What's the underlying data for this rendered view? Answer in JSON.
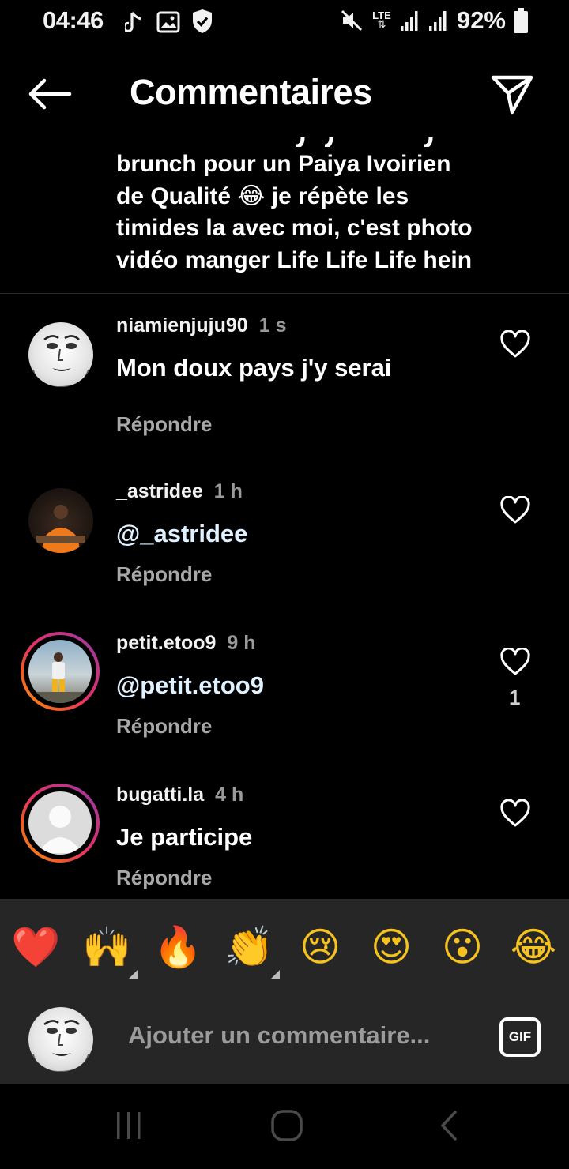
{
  "status_bar": {
    "time": "04:46",
    "lte": "LTE",
    "battery": "92%",
    "icons": [
      "music-note-icon",
      "image-icon",
      "shield-icon",
      "mute-icon",
      "lte-icon",
      "signal-icon",
      "signal-icon",
      "battery-icon"
    ]
  },
  "header": {
    "title": "Commentaires",
    "back_icon": "arrow-left-icon",
    "send_icon": "send-icon"
  },
  "caption": {
    "line1": "brunch  pour un Paiya Ivoirien",
    "line2": "de Qualité 😂 je répète les",
    "line3": "timides la avec moi, c'est photo",
    "line4": "vidéo manger Life Life Life hein"
  },
  "comments": [
    {
      "username": "niamienjuju90",
      "time": "1 s",
      "text": "Mon doux pays j'y serai",
      "reply": "Répondre",
      "likes": ""
    },
    {
      "username": "_astridee",
      "time": "1 h",
      "text": "@_astridee",
      "reply": "Répondre",
      "likes": ""
    },
    {
      "username": "petit.etoo9",
      "time": "9 h",
      "text": "@petit.etoo9",
      "reply": "Répondre",
      "likes": "1"
    },
    {
      "username": "bugatti.la",
      "time": "4 h",
      "text": "Je participe",
      "reply": "Répondre",
      "likes": ""
    }
  ],
  "emoji_bar": [
    "❤️",
    "🙌",
    "🔥",
    "👏",
    "😢",
    "😍",
    "😮",
    "😂"
  ],
  "composer": {
    "placeholder": "Ajouter un commentaire...",
    "gif_label": "GIF"
  },
  "nav_bar": {
    "icons": [
      "recent-apps-icon",
      "home-icon",
      "back-icon"
    ]
  },
  "colors": {
    "background": "#000000",
    "panel": "#262626",
    "mention": "#e0f1ff",
    "muted": "#a8a8a8"
  }
}
